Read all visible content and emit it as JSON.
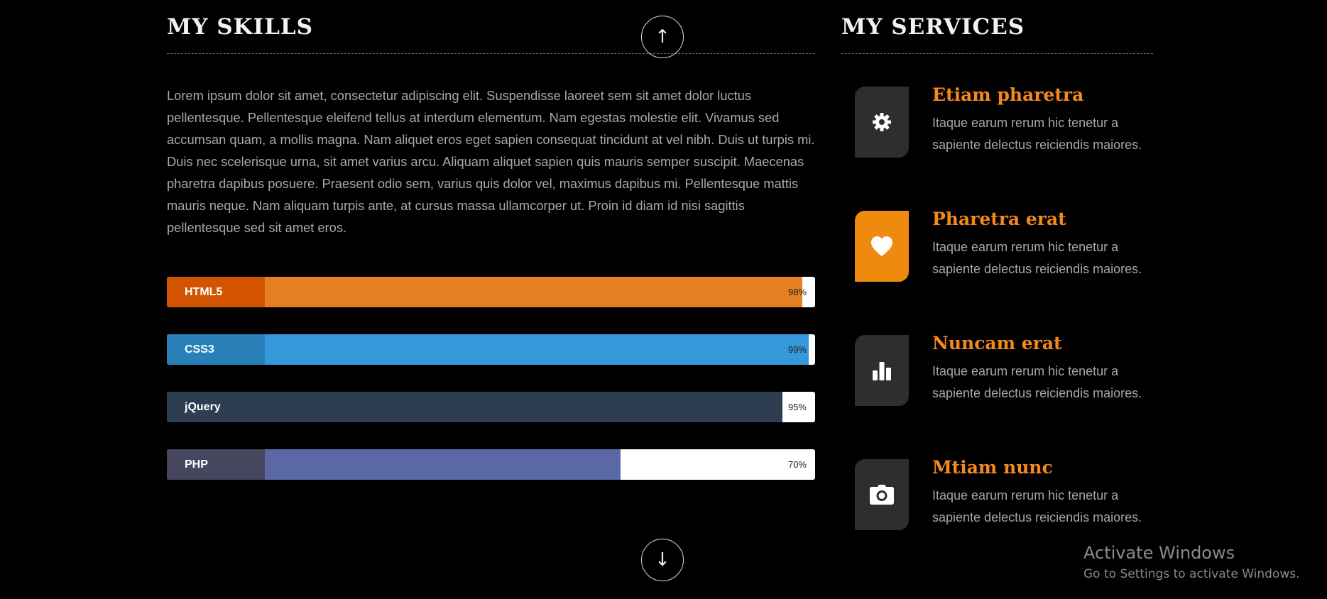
{
  "skills": {
    "title": "MY SKILLS",
    "paragraph": "Lorem ipsum dolor sit amet, consectetur adipiscing elit. Suspendisse laoreet sem sit amet dolor luctus pellentesque. Pellentesque eleifend tellus at interdum elementum. Nam egestas molestie elit. Vivamus sed accumsan quam, a mollis magna. Nam aliquet eros eget sapien consequat tincidunt at vel nibh. Duis ut turpis mi. Duis nec scelerisque urna, sit amet varius arcu. Aliquam aliquet sapien quis mauris semper suscipit. Maecenas pharetra dapibus posuere. Praesent odio sem, varius quis dolor vel, maximus dapibus mi. Pellentesque mattis mauris neque. Nam aliquam turpis ante, at cursus massa ullamcorper ut. Proin id diam id nisi sagittis pellentesque sed sit amet eros.",
    "bars": [
      {
        "label": "HTML5",
        "percent_text": "98%",
        "value": 98,
        "label_color": "#d35400",
        "fill_color": "#e67e22"
      },
      {
        "label": "CSS3",
        "percent_text": "99%",
        "value": 99,
        "label_color": "#2980b9",
        "fill_color": "#3498db"
      },
      {
        "label": "jQuery",
        "percent_text": "95%",
        "value": 95,
        "label_color": "#2c3e50",
        "fill_color": "#2c3e50"
      },
      {
        "label": "PHP",
        "percent_text": "70%",
        "value": 70,
        "label_color": "#46465e",
        "fill_color": "#5a68a5"
      }
    ]
  },
  "services": {
    "title": "MY SERVICES",
    "items": [
      {
        "icon": "gear-icon",
        "title": "Etiam pharetra",
        "description": "Itaque earum rerum hic tenetur a sapiente delectus reiciendis maiores.",
        "active": false
      },
      {
        "icon": "heart-icon",
        "title": "Pharetra erat",
        "description": "Itaque earum rerum hic tenetur a sapiente delectus reiciendis maiores.",
        "active": true
      },
      {
        "icon": "bar-chart-icon",
        "title": "Nuncam erat",
        "description": "Itaque earum rerum hic tenetur a sapiente delectus reiciendis maiores.",
        "active": false
      },
      {
        "icon": "camera-icon",
        "title": "Mtiam nunc",
        "description": "Itaque earum rerum hic tenetur a sapiente delectus reiciendis maiores.",
        "active": false
      }
    ]
  },
  "nav": {
    "up_arrow": "↑",
    "down_arrow": "↓"
  },
  "watermark": {
    "title": "Activate Windows",
    "subtitle": "Go to Settings to activate Windows."
  },
  "colors": {
    "accent": "#f08a0e",
    "background": "#000000"
  }
}
